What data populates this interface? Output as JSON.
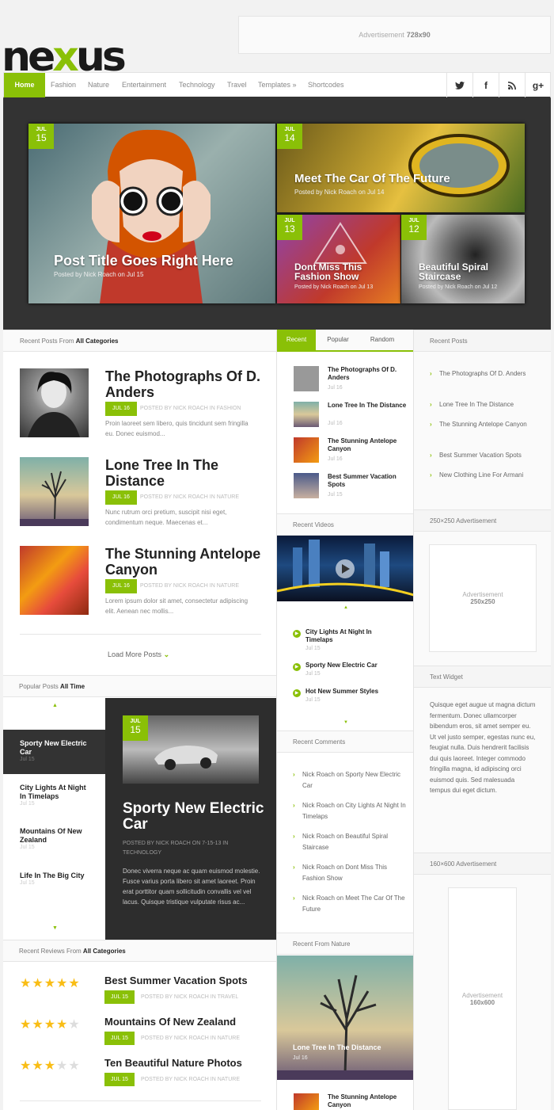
{
  "top_ad": {
    "label": "Advertisement",
    "size": "728x90"
  },
  "logo": {
    "pre": "ne",
    "x": "x",
    "post": "us"
  },
  "nav": {
    "home": "Home",
    "items": [
      "Fashion",
      "Nature",
      "Entertainment",
      "Technology",
      "Travel",
      "Templates »",
      "Shortcodes"
    ],
    "social": [
      "t",
      "f",
      "rss",
      "g+"
    ]
  },
  "slider": [
    {
      "month": "JUL",
      "day": "15",
      "title": "Post Title Goes Right Here",
      "meta": "Posted by Nick Roach on Jul 15"
    },
    {
      "month": "JUL",
      "day": "14",
      "title": "Meet The Car Of The Future",
      "meta": "Posted by Nick Roach on Jul 14"
    },
    {
      "month": "JUL",
      "day": "13",
      "title": "Dont Miss This Fashion Show",
      "meta": "Posted by Nick Roach on Jul 13"
    },
    {
      "month": "JUL",
      "day": "12",
      "title": "Beautiful Spiral Staircase",
      "meta": "Posted by Nick Roach on Jul 12"
    }
  ],
  "recent_posts": {
    "label": "Recent Posts From",
    "bold": "All Categories",
    "items": [
      {
        "title": "The Photographs Of D. Anders",
        "date": "JUL 16",
        "by": "POSTED BY NICK ROACH IN FASHION",
        "excerpt": "Proin laoreet sem libero, quis tincidunt sem fringilla eu. Donec euismod..."
      },
      {
        "title": "Lone Tree In The Distance",
        "date": "JUL 16",
        "by": "POSTED BY NICK ROACH IN NATURE",
        "excerpt": "Nunc rutrum orci pretium, suscipit nisi eget, condimentum neque. Maecenas et..."
      },
      {
        "title": "The Stunning Antelope Canyon",
        "date": "JUL 16",
        "by": "POSTED BY NICK ROACH IN NATURE",
        "excerpt": "Lorem ipsum dolor sit amet, consectetur adipiscing elit. Aenean nec mollis..."
      }
    ],
    "load_more": "Load More Posts"
  },
  "popular_posts": {
    "label": "Popular Posts",
    "bold": "All Time",
    "list": [
      {
        "title": "Sporty New Electric Car",
        "date": "Jul 15"
      },
      {
        "title": "City Lights At Night In Timelaps",
        "date": "Jul 15"
      },
      {
        "title": "Mountains Of New Zealand",
        "date": "Jul 15"
      },
      {
        "title": "Life In The Big City",
        "date": "Jul 15"
      }
    ],
    "featured": {
      "month": "JUL",
      "day": "15",
      "title": "Sporty New Electric Car",
      "meta": "POSTED BY NICK ROACH ON 7-15-13 IN TECHNOLOGY",
      "excerpt": "Donec viverra neque ac quam euismod molestie. Fusce varius porta libero sit amet laoreet. Proin erat porttitor quam sollicitudin convallis vel vel lacus. Quisque tristique vulputate risus ac..."
    }
  },
  "recent_reviews": {
    "label": "Recent Reviews From",
    "bold": "All Categories",
    "items": [
      {
        "title": "Best Summer Vacation Spots",
        "rating": 5,
        "date": "JUL 15",
        "by": "POSTED BY NICK ROACH IN TRAVEL"
      },
      {
        "title": "Mountains Of New Zealand",
        "rating": 4,
        "date": "JUL 15",
        "by": "POSTED BY NICK ROACH IN NATURE"
      },
      {
        "title": "Ten Beautiful Nature Photos",
        "rating": 3,
        "date": "JUL 15",
        "by": "POSTED BY NICK ROACH IN NATURE"
      }
    ]
  },
  "tabs": {
    "items": [
      "Recent",
      "Popular",
      "Random"
    ],
    "posts": [
      {
        "title": "The Photographs Of D. Anders",
        "date": "Jul 16"
      },
      {
        "title": "Lone Tree In The Distance",
        "date": "Jul 16"
      },
      {
        "title": "The Stunning Antelope Canyon",
        "date": "Jul 16"
      },
      {
        "title": "Best Summer Vacation Spots",
        "date": "Jul 15"
      }
    ]
  },
  "recent_videos": {
    "label": "Recent Videos",
    "items": [
      {
        "title": "City Lights At Night In Timelaps",
        "date": "Jul 15"
      },
      {
        "title": "Sporty New Electric Car",
        "date": "Jul 15"
      },
      {
        "title": "Hot New Summer Styles",
        "date": "Jul 15"
      }
    ]
  },
  "recent_comments": {
    "label": "Recent Comments",
    "items": [
      "Nick Roach on Sporty New Electric Car",
      "Nick Roach on City Lights At Night In Timelaps",
      "Nick Roach on Beautiful Spiral Staircase",
      "Nick Roach on Dont Miss This Fashion Show",
      "Nick Roach on Meet The Car Of The Future"
    ]
  },
  "recent_nature": {
    "label": "Recent From Nature",
    "featured_title": "Lone Tree In The Distance",
    "featured_date": "Jul 16",
    "next_title": "The Stunning Antelope Canyon"
  },
  "sidebar_recent": {
    "label": "Recent Posts",
    "items": [
      "The Photographs Of D. Anders",
      "Lone Tree In The Distance",
      "The Stunning Antelope Canyon",
      "Best Summer Vacation Spots",
      "New Clothing Line For Armani"
    ]
  },
  "ad250": {
    "label": "250×250 Advertisement",
    "box_label": "Advertisement",
    "box_size": "250x250"
  },
  "text_widget": {
    "label": "Text Widget",
    "text": "Quisque eget augue ut magna dictum fermentum. Donec ullamcorper bibendum eros, sit amet semper eu. Ut vel justo semper, egestas nunc eu, feugiat nulla. Duis hendrerit facilisis dui quis laoreet. Integer commodo fringilla magna, id adipiscing orci euismod quis. Sed malesuada tempus dui eget dictum."
  },
  "ad160": {
    "label": "160×600 Advertisement",
    "box_label": "Advertisement",
    "box_size": "160x600"
  },
  "colors": {
    "accent": "#8ac007",
    "dark": "#333333"
  }
}
